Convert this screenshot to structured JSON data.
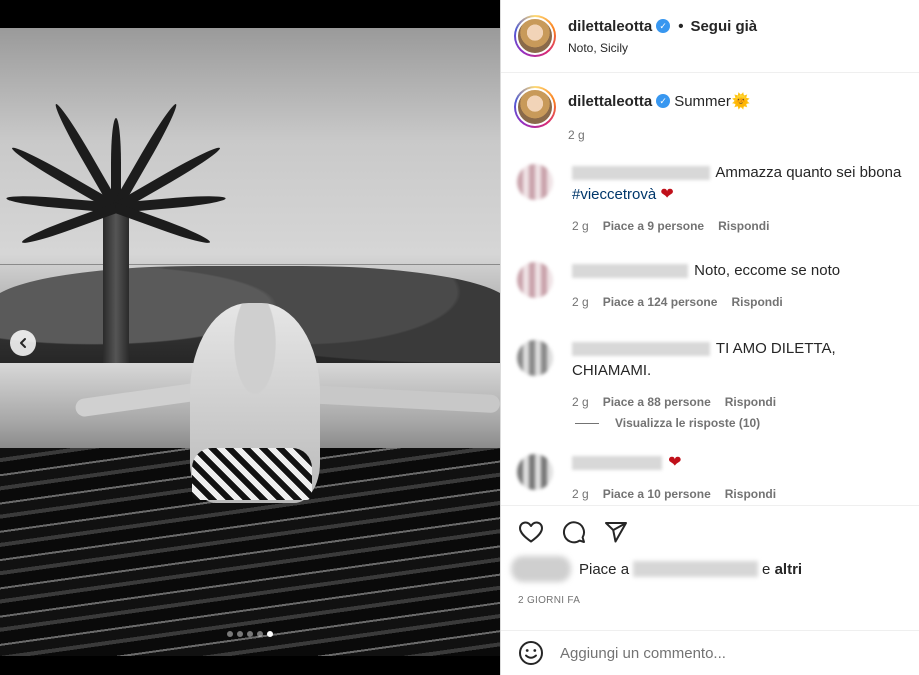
{
  "post": {
    "username": "dilettaleotta",
    "follow_status": "Segui già",
    "separator": "•",
    "location": "Noto, Sicily",
    "verified_mark": "✓"
  },
  "caption": {
    "username": "dilettaleotta",
    "text": "Summer",
    "emoji": "🌞",
    "age": "2 g"
  },
  "comments": [
    {
      "text": "Ammazza quanto sei bbona",
      "hashtag": "#vieccetrovà",
      "heart": "❤",
      "age": "2 g",
      "likes": "Piace a 9 persone",
      "reply": "Rispondi"
    },
    {
      "text": "Noto, eccome se noto",
      "age": "2 g",
      "likes": "Piace a 124 persone",
      "reply": "Rispondi"
    },
    {
      "text": "TI AMO DILETTA, CHIAMAMI.",
      "age": "2 g",
      "likes": "Piace a 88 persone",
      "reply": "Rispondi"
    },
    {
      "text": "",
      "heart": "❤",
      "age": "2 g",
      "likes": "Piace a 10 persone",
      "reply": "Rispondi"
    }
  ],
  "view_replies": "Visualizza le risposte (10)",
  "likes_bar": {
    "prefix": "Piace a",
    "connector": "e",
    "others": "altri"
  },
  "timestamp": "2 GIORNI FA",
  "add_comment": {
    "placeholder": "Aggiungi un commento..."
  },
  "carousel": {
    "total": 5,
    "active_index": 4
  },
  "icons": {
    "like": "heart-outline-icon",
    "comment": "speech-bubble-icon",
    "share": "paper-plane-icon",
    "emoji": "smiley-icon",
    "prev": "chevron-left-icon"
  }
}
